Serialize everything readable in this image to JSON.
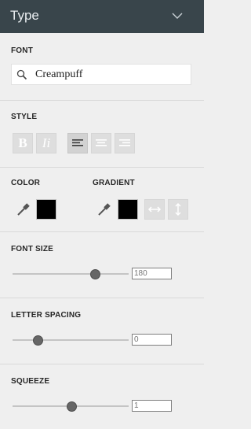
{
  "header": {
    "title": "Type",
    "collapse_icon": "chevron-down-icon"
  },
  "font": {
    "label": "FONT",
    "value": "Creampuff",
    "icon": "search-icon"
  },
  "style": {
    "label": "STYLE",
    "bold_glyph": "B",
    "italic_glyph": "Ii",
    "align_active": "left",
    "buttons": [
      "bold",
      "italic",
      "align-left",
      "align-center",
      "align-right"
    ]
  },
  "color": {
    "label": "COLOR",
    "swatch": "#000000",
    "picker_icon": "eyedropper-icon"
  },
  "gradient": {
    "label": "GRADIENT",
    "swatch": "#000000",
    "icons": [
      "eyedropper-icon",
      "horizontal-arrows-icon",
      "vertical-arrows-icon"
    ]
  },
  "font_size": {
    "label": "FONT SIZE",
    "value": "180",
    "slider_fraction": 0.71
  },
  "letter_spacing": {
    "label": "LETTER SPACING",
    "value": "0",
    "slider_fraction": 0.22
  },
  "squeeze": {
    "label": "SQUEEZE",
    "value": "1",
    "slider_fraction": 0.51
  },
  "colors": {
    "header_bg": "#39454b",
    "panel_bg": "#efefef",
    "thumb": "#666666"
  }
}
